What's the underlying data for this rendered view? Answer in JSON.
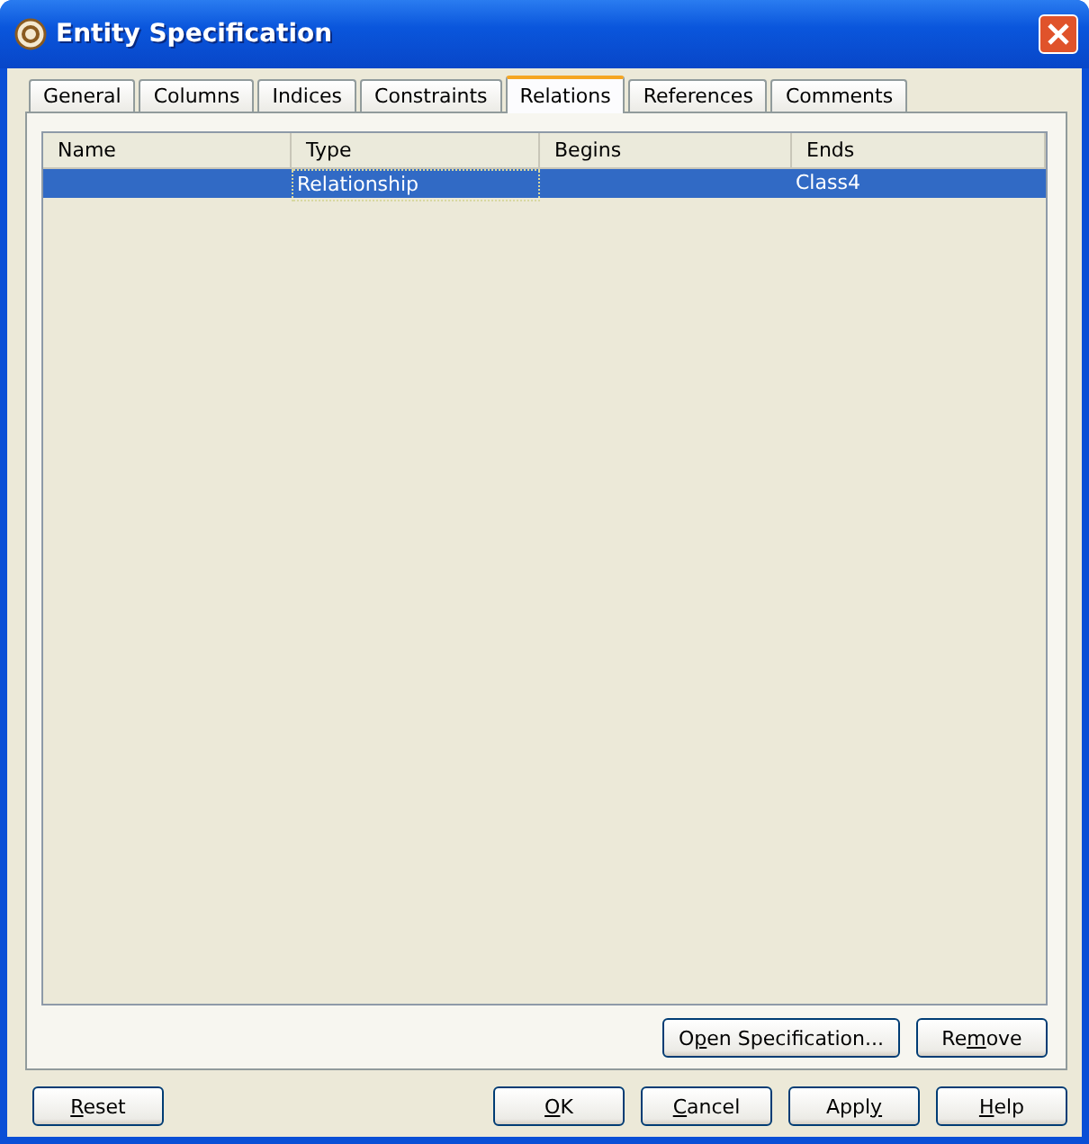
{
  "window": {
    "title": "Entity Specification"
  },
  "tabs": [
    {
      "label": "General",
      "selected": false
    },
    {
      "label": "Columns",
      "selected": false
    },
    {
      "label": "Indices",
      "selected": false
    },
    {
      "label": "Constraints",
      "selected": false
    },
    {
      "label": "Relations",
      "selected": true
    },
    {
      "label": "References",
      "selected": false
    },
    {
      "label": "Comments",
      "selected": false
    }
  ],
  "table": {
    "columns": [
      "Name",
      "Type",
      "Begins",
      "Ends"
    ],
    "rows": [
      {
        "cells": [
          "",
          "Relationship",
          "",
          "Class4"
        ],
        "selected": true
      }
    ]
  },
  "panel_buttons": [
    {
      "label_parts": [
        {
          "text": "O",
          "underlined": false
        },
        {
          "text": "p",
          "underlined": true
        },
        {
          "text": "en Specification...",
          "underlined": false
        }
      ]
    },
    {
      "label_parts": [
        {
          "text": "Re",
          "underlined": false
        },
        {
          "text": "m",
          "underlined": true
        },
        {
          "text": "ove",
          "underlined": false
        }
      ]
    }
  ],
  "left_buttons": [
    {
      "label_parts": [
        {
          "text": "R",
          "underlined": true
        },
        {
          "text": "eset",
          "underlined": false
        }
      ]
    }
  ],
  "right_buttons": [
    {
      "label_parts": [
        {
          "text": "O",
          "underlined": true
        },
        {
          "text": "K",
          "underlined": false
        }
      ]
    },
    {
      "label_parts": [
        {
          "text": "C",
          "underlined": true
        },
        {
          "text": "ancel",
          "underlined": false
        }
      ]
    },
    {
      "label_parts": [
        {
          "text": "Appl",
          "underlined": false
        },
        {
          "text": "y",
          "underlined": true
        }
      ]
    },
    {
      "label_parts": [
        {
          "text": "H",
          "underlined": true
        },
        {
          "text": "elp",
          "underlined": false
        }
      ]
    }
  ]
}
